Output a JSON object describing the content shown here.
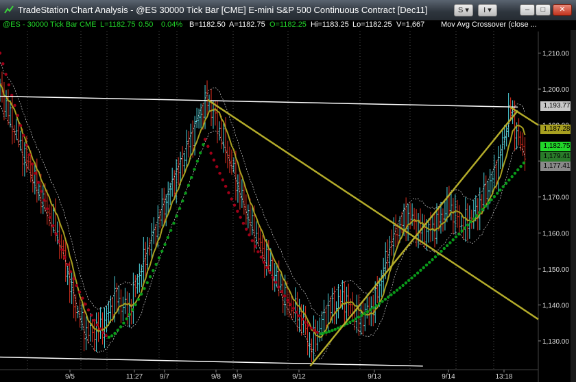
{
  "window": {
    "title": "TradeStation Chart Analysis - @ES 30000 Tick Bar [CME] E-mini S&P 500 Continuous Contract [Dec11]",
    "btn_s": "S ▾",
    "btn_i": "I ▾",
    "min": "–",
    "max": "□",
    "close": "✕"
  },
  "info": {
    "symbol": "@ES - 30000 Tick Bar  CME",
    "last": "L=1182.75",
    "change": "0.50",
    "pct": "0.04%",
    "bid": "B=1182.50",
    "ask": "A=1182.75",
    "open": "O=1182.25",
    "high": "Hi=1183.25",
    "low": "Lo=1182.25",
    "volume": "V=1,667",
    "study": "Mov Avg Crossover (close ..."
  },
  "colors": {
    "up_bar": "#4fd6e0",
    "down_bar": "#e03020",
    "ma": "#a8a020",
    "trend": "#b4ac2a",
    "sar_up": "#0a9a1a",
    "sar_down": "#a00018",
    "info_green": "#22d62a"
  },
  "y_axis": {
    "ticks": [
      "1,210.00",
      "1,200.00",
      "1,190.00",
      "1,180.00",
      "1,170.00",
      "1,160.00",
      "1,150.00",
      "1,140.00",
      "1,130.00"
    ]
  },
  "x_axis": {
    "ticks": [
      "9/5",
      "11:27",
      "9/7",
      "9/8",
      "9/9",
      "9/12",
      "9/13",
      "9/14",
      "13:18"
    ]
  },
  "price_labels": [
    {
      "text": "1,193.77",
      "bg": "#c8c8c8",
      "fg": "#000"
    },
    {
      "text": "1,187.28",
      "bg": "#a8a020",
      "fg": "#000"
    },
    {
      "text": "1,182.75",
      "bg": "#22d62a",
      "fg": "#000"
    },
    {
      "text": "1,179.41",
      "bg": "#2a7a2a",
      "fg": "#000"
    },
    {
      "text": "1,177.41",
      "bg": "#8a8a8a",
      "fg": "#000"
    }
  ],
  "chart_data": {
    "type": "candlestick",
    "ylim": [
      1122,
      1216
    ],
    "price_path": [
      [
        0,
        1200
      ],
      [
        15,
        1185
      ],
      [
        30,
        1172
      ],
      [
        45,
        1160
      ],
      [
        58,
        1140
      ],
      [
        68,
        1132
      ],
      [
        80,
        1134
      ],
      [
        90,
        1142
      ],
      [
        100,
        1138
      ],
      [
        110,
        1150
      ],
      [
        125,
        1165
      ],
      [
        140,
        1178
      ],
      [
        155,
        1192
      ],
      [
        162,
        1197
      ],
      [
        175,
        1185
      ],
      [
        190,
        1168
      ],
      [
        205,
        1155
      ],
      [
        215,
        1148
      ],
      [
        225,
        1140
      ],
      [
        235,
        1137
      ],
      [
        242,
        1128
      ],
      [
        255,
        1138
      ],
      [
        268,
        1142
      ],
      [
        280,
        1136
      ],
      [
        292,
        1140
      ],
      [
        305,
        1158
      ],
      [
        318,
        1165
      ],
      [
        330,
        1160
      ],
      [
        340,
        1162
      ],
      [
        350,
        1168
      ],
      [
        360,
        1162
      ],
      [
        370,
        1165
      ],
      [
        380,
        1172
      ],
      [
        388,
        1178
      ],
      [
        398,
        1195
      ],
      [
        404,
        1186
      ],
      [
        410,
        1183
      ]
    ],
    "trendlines": [
      {
        "from": [
          0.0,
          1198.0
        ],
        "to": [
          404.0,
          1195.0
        ],
        "color": "#ffffff"
      },
      {
        "from": [
          0.0,
          1125.5
        ],
        "to": [
          330.0,
          1123.0
        ],
        "color": "#ffffff"
      },
      {
        "from": [
          162.0,
          1197.0
        ],
        "to": [
          420.0,
          1136.0
        ],
        "color": "#b4ac2a"
      },
      {
        "from": [
          242.0,
          1123.0
        ],
        "to": [
          404.0,
          1194.0
        ],
        "color": "#b4ac2a"
      },
      {
        "from": [
          398.0,
          1195.0
        ],
        "to": [
          420.0,
          1190.0
        ],
        "color": "#b4ac2a"
      }
    ],
    "x_positions": [
      0,
      15,
      30,
      45,
      58,
      68,
      80,
      90,
      100,
      110,
      125,
      140,
      155,
      162,
      175,
      190,
      205,
      215,
      225,
      235,
      242,
      255,
      268,
      280,
      292,
      305,
      318,
      330,
      340,
      350,
      360,
      370,
      380,
      388,
      398,
      404,
      410
    ]
  }
}
